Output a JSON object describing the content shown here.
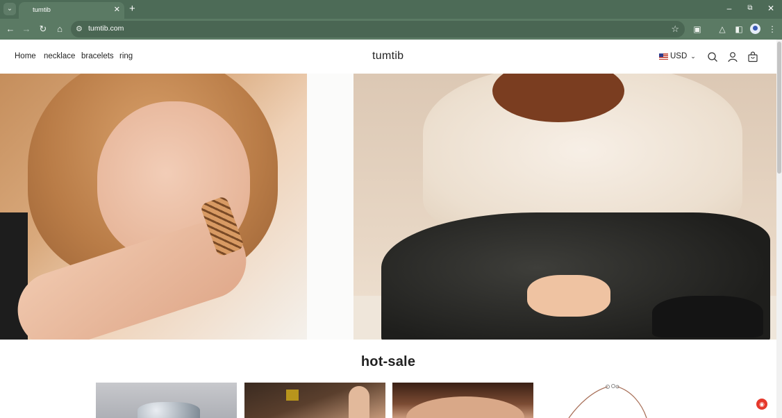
{
  "browser": {
    "tab_title": "tumtib",
    "url": "tumtib.com"
  },
  "site": {
    "brand": "tumtib",
    "nav": [
      {
        "label": "Home"
      },
      {
        "label": "necklace"
      },
      {
        "label": "bracelets"
      },
      {
        "label": "ring"
      }
    ],
    "currency": "USD"
  },
  "hot_sale": {
    "title": "hot-sale"
  }
}
